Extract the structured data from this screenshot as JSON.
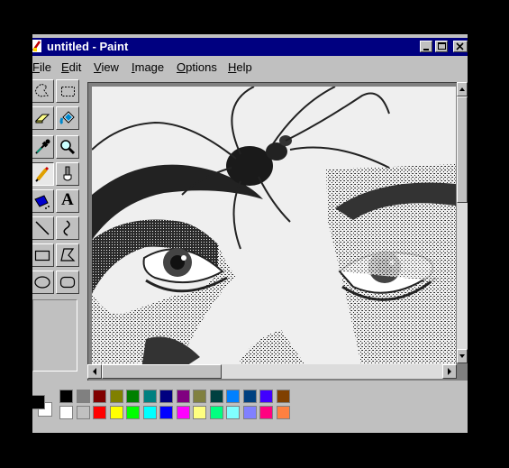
{
  "window": {
    "title": "untitled - Paint"
  },
  "menu": [
    "File",
    "Edit",
    "View",
    "Image",
    "Options",
    "Help"
  ],
  "tools": [
    {
      "name": "free-form-select-icon"
    },
    {
      "name": "select-icon"
    },
    {
      "name": "eraser-icon"
    },
    {
      "name": "fill-with-color-icon"
    },
    {
      "name": "pick-color-icon"
    },
    {
      "name": "magnifier-icon"
    },
    {
      "name": "pencil-icon",
      "selected": true
    },
    {
      "name": "brush-icon"
    },
    {
      "name": "airbrush-icon"
    },
    {
      "name": "text-icon",
      "glyph": "A"
    },
    {
      "name": "line-icon"
    },
    {
      "name": "curve-icon"
    },
    {
      "name": "rectangle-icon"
    },
    {
      "name": "polygon-icon"
    },
    {
      "name": "ellipse-icon"
    },
    {
      "name": "rounded-rectangle-icon"
    }
  ],
  "palette": {
    "foreground": "#000000",
    "background": "#ffffff",
    "row1": [
      "#000000",
      "#808080",
      "#800000",
      "#808000",
      "#008000",
      "#008080",
      "#000080",
      "#800080",
      "#808040",
      "#004040",
      "#0080ff",
      "#004080",
      "#4000ff",
      "#804000"
    ],
    "row2": [
      "#ffffff",
      "#c0c0c0",
      "#ff0000",
      "#ffff00",
      "#00ff00",
      "#00ffff",
      "#0000ff",
      "#ff00ff",
      "#ffff80",
      "#00ff80",
      "#80ffff",
      "#8080ff",
      "#ff0080",
      "#ff8040"
    ]
  },
  "canvas": {
    "image": "drawing-of-eyes-with-spider"
  }
}
